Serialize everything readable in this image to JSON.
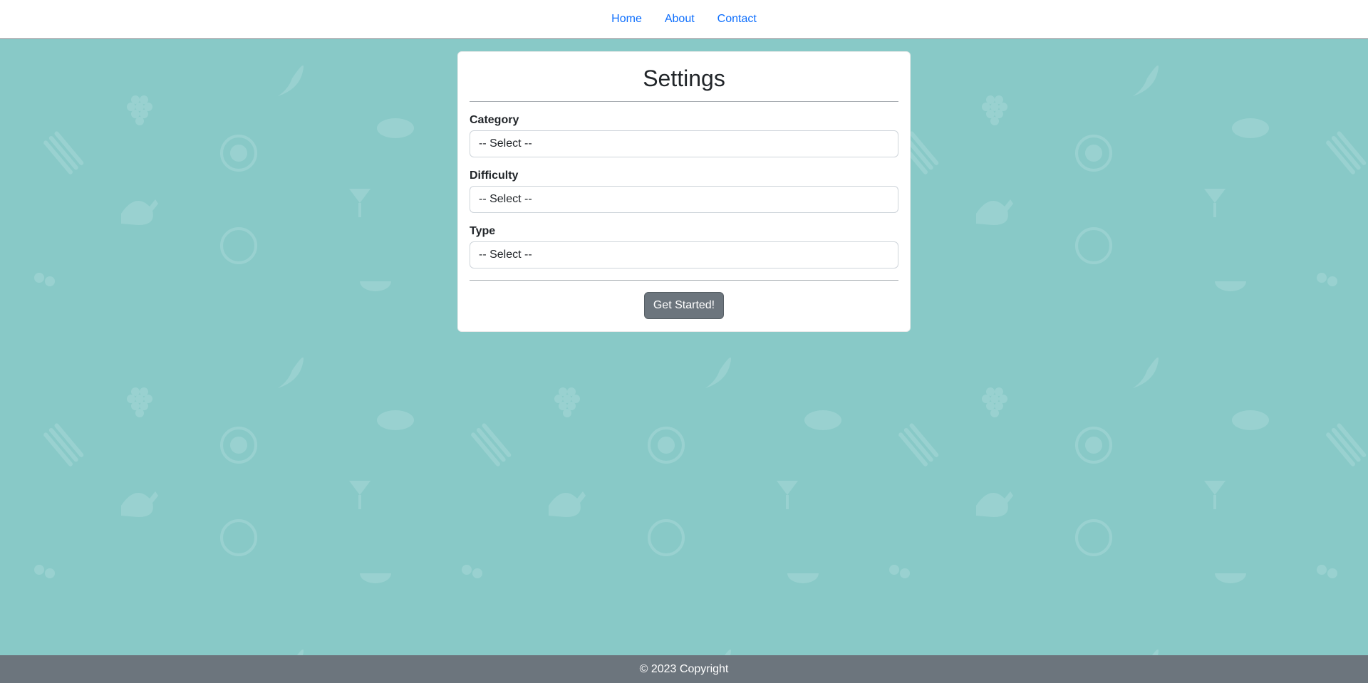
{
  "nav": {
    "items": [
      {
        "label": "Home"
      },
      {
        "label": "About"
      },
      {
        "label": "Contact"
      }
    ]
  },
  "settings": {
    "title": "Settings",
    "fields": [
      {
        "label": "Category",
        "value": "-- Select --"
      },
      {
        "label": "Difficulty",
        "value": "-- Select --"
      },
      {
        "label": "Type",
        "value": "-- Select --"
      }
    ],
    "submit_label": "Get Started!"
  },
  "footer": {
    "text": "© 2023 Copyright"
  },
  "colors": {
    "background": "#88c9c7",
    "link": "#0d6efd",
    "button": "#6c757d",
    "footer": "#6c757d"
  }
}
